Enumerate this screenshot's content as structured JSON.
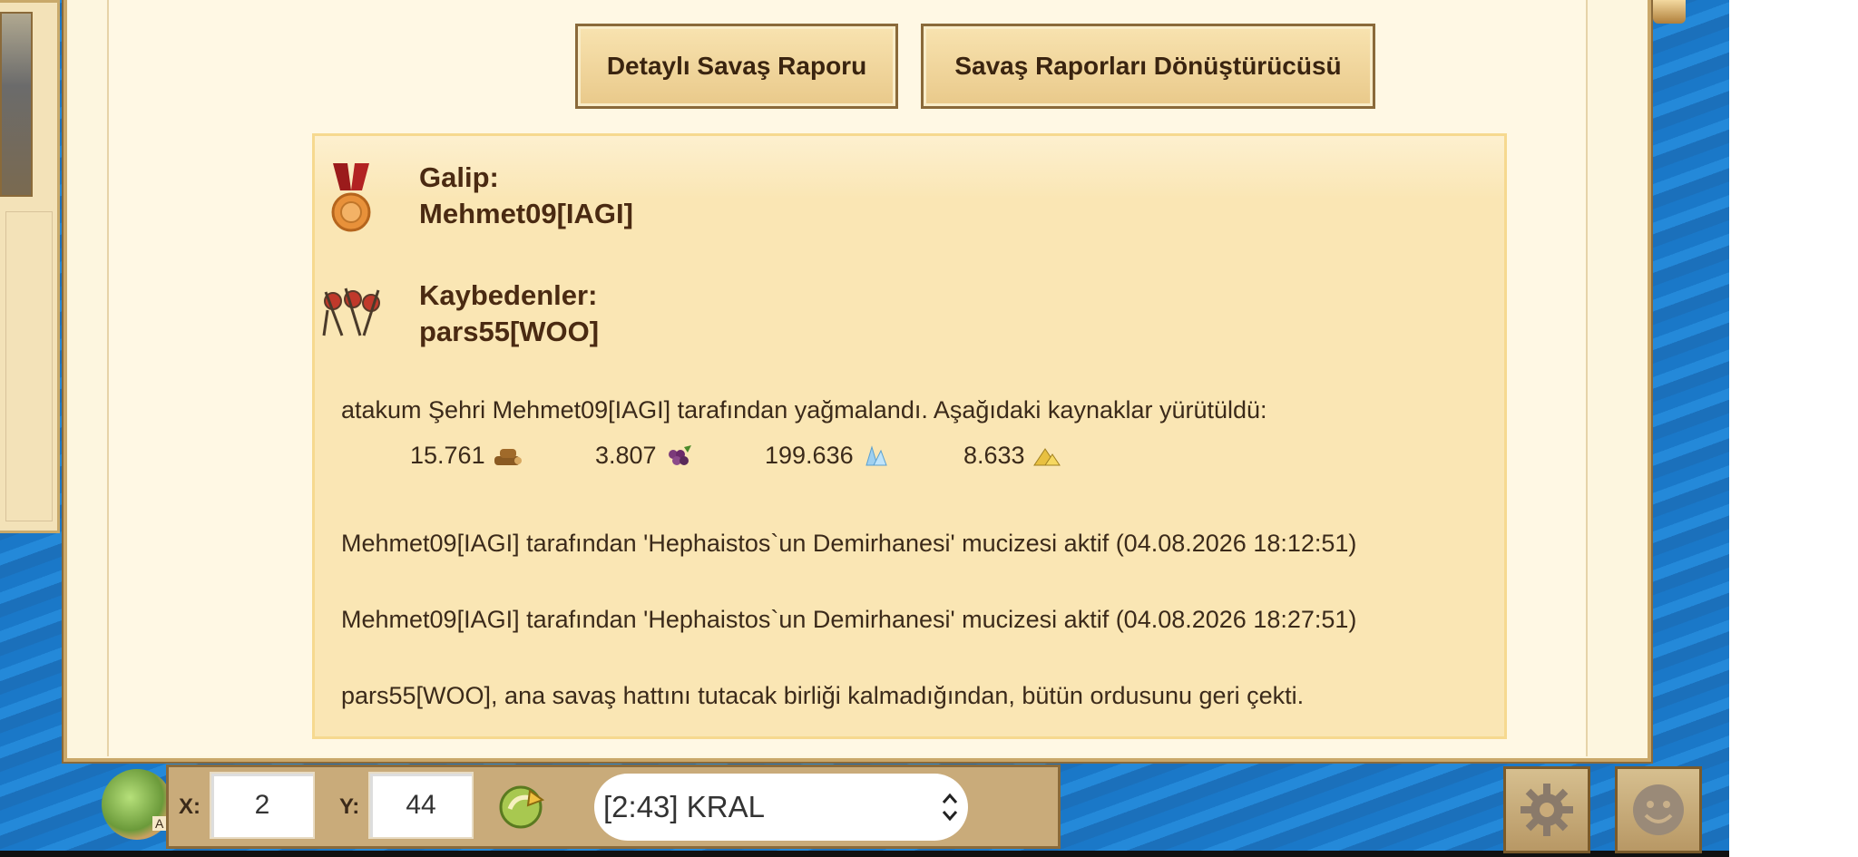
{
  "buttons": {
    "detailed_report": "Detaylı Savaş Raporu",
    "report_converter": "Savaş Raporları Dönüştürücüsü"
  },
  "report": {
    "winner_label": "Galip:",
    "winner_name": "Mehmet09[IAGI]",
    "losers_label": "Kaybedenler:",
    "loser_name": "pars55[WOO]",
    "loot_text": "atakum Şehri Mehmet09[IAGI] tarafından yağmalandı. Aşağıdaki kaynaklar yürütüldü:",
    "resources": [
      {
        "icon": "wood-icon",
        "value": "15.761"
      },
      {
        "icon": "wine-icon",
        "value": "3.807"
      },
      {
        "icon": "crystal-icon",
        "value": "199.636"
      },
      {
        "icon": "sulfur-icon",
        "value": "8.633"
      }
    ],
    "wonder_line_1": "Mehmet09[IAGI] tarafından 'Hephaistos`un Demirhanesi' mucizesi aktif (04.08.2026 18:12:51)",
    "wonder_line_2": "Mehmet09[IAGI] tarafından 'Hephaistos`un Demirhanesi' mucizesi aktif (04.08.2026 18:27:51)",
    "retreat_line": "pars55[WOO], ana savaş hattını tutacak birliği kalmadığından, bütün ordusunu geri çekti."
  },
  "navigation": {
    "x_label": "X:",
    "x_value": "2",
    "y_label": "Y:",
    "y_value": "44",
    "island_selected": "[2:43] KRAL",
    "island_marker": "A"
  },
  "colors": {
    "window_bg": "#fdf6df",
    "report_bg": "#fae6b4",
    "text_brown": "#3b2a1a",
    "sea_blue": "#1c7fd0"
  }
}
